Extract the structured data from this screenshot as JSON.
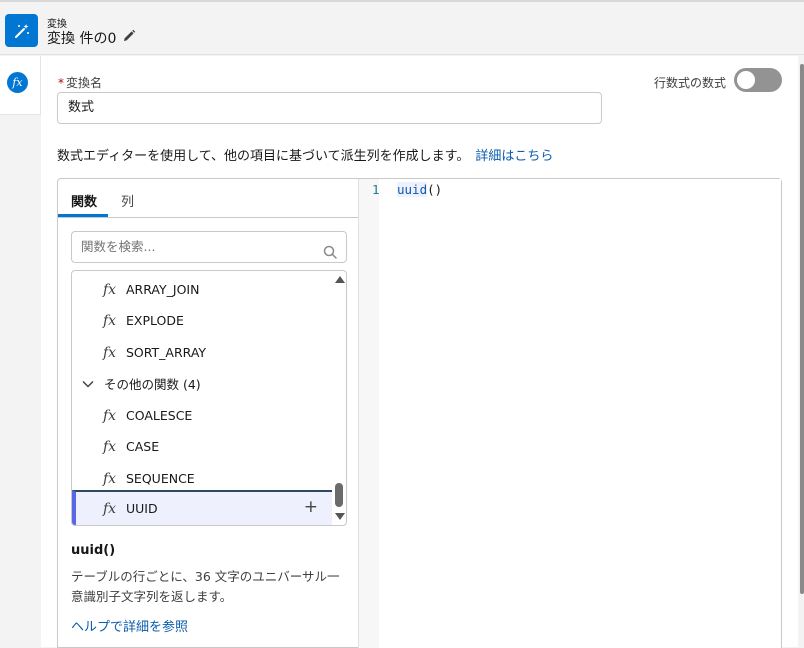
{
  "header": {
    "small_label": "変換",
    "title": "変換 件の0",
    "edit_icon": "pencil-icon",
    "app_icon": "magic-wand-icon"
  },
  "rail": {
    "icon": "fx-icon",
    "icon_text": "fx"
  },
  "form": {
    "name_label": "変換名",
    "required_mark": "*",
    "name_value": "数式",
    "toggle_label": "行数式の数式",
    "toggle_on": false,
    "description": "数式エディターを使用して、他の項目に基づいて派生列を作成します。",
    "description_link": "詳細はこちら"
  },
  "functions_pane": {
    "tabs": [
      {
        "label": "関数",
        "active": true
      },
      {
        "label": "列",
        "active": false
      }
    ],
    "search_placeholder": "関数を検索...",
    "fx_glyph": "fx",
    "items": [
      {
        "label": "ARRAY_JOIN"
      },
      {
        "label": "EXPLODE"
      },
      {
        "label": "SORT_ARRAY"
      }
    ],
    "group": {
      "label": "その他の関数 (4)",
      "expanded": true
    },
    "group_items": [
      {
        "label": "COALESCE"
      },
      {
        "label": "CASE"
      },
      {
        "label": "SEQUENCE"
      },
      {
        "label": "UUID",
        "selected": true
      }
    ],
    "add_glyph": "+",
    "selected_function": {
      "signature": "uuid()",
      "description": "テーブルの行ごとに、36 文字のユニバーサル一意識別子文字列を返します。",
      "help_link": "ヘルプで詳細を参照"
    }
  },
  "editor": {
    "line_number": "1",
    "code_fn": "uuid",
    "code_parens": "()"
  },
  "colors": {
    "brand": "#0176d3",
    "link": "#0b5cab",
    "selected_bg": "#eef1fd",
    "selected_bar": "#5867e8",
    "required": "#ba0517"
  }
}
